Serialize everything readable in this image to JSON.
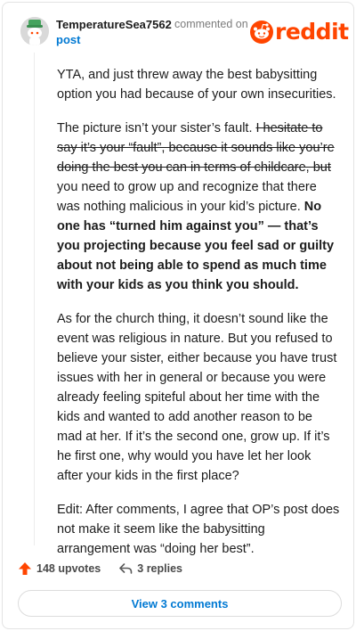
{
  "header": {
    "username": "TemperatureSea7562",
    "commented_on": "commented on",
    "post_link": "post",
    "logo_text": "reddit"
  },
  "comment": {
    "p1": "YTA, and just threw away the best babysitting option you had because of your own insecurities.",
    "p2_plain": "The picture isn’t your sister’s fault. ",
    "p2_strike": "I hesitate to say it’s your “fault”, because it sounds like you’re doing the best you can in terms of childcare, but",
    "p2_mid": " you need to grow up and recognize that there was nothing malicious in your kid’s picture. ",
    "p2_bold": "No one has “turned him against you” — that’s you projecting because you feel sad or guilty about not being able to spend as much time with your kids as you think you should.",
    "p3": "As for the church thing, it doesn’t sound like the event was religious in nature. But you refused to believe your sister, either because you have trust issues with her in general or because you were already feeling spiteful about her time with the kids and wanted to add another reason to be mad at her. If it’s the second one, grow up. If it’s he first one, why would you have let her look after your kids in the first place?",
    "p4": "Edit: After comments, I agree that OP’s post does not make it seem like the babysitting arrangement was “doing her best”."
  },
  "footer": {
    "upvotes": "148 upvotes",
    "replies": "3 replies",
    "view_comments": "View 3 comments"
  },
  "colors": {
    "reddit_orange": "#ff4500",
    "link_blue": "#0079d3",
    "muted_gray": "#7c7c7c"
  },
  "icons": {
    "avatar": "snoo-avatar-icon",
    "logo": "reddit-alien-icon",
    "upvote": "upvote-arrow-icon",
    "reply": "reply-arrow-icon"
  }
}
